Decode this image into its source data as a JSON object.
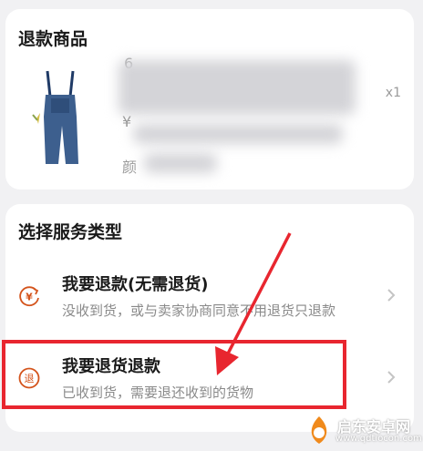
{
  "refund_items": {
    "title": "退款商品",
    "quantity": "x1",
    "fragment_top": "6",
    "fragment_mid": "¥",
    "fragment_bottom": "颜"
  },
  "service_type": {
    "title": "选择服务类型",
    "options": [
      {
        "title": "我要退款(无需退货)",
        "subtitle": "没收到货，或与卖家协商同意不用退货只退款",
        "icon_text": "¥"
      },
      {
        "title": "我要退货退款",
        "subtitle": "已收到货，需要退还收到的货物",
        "icon_text": "退"
      }
    ]
  },
  "colors": {
    "icon_orange": "#d4541c",
    "highlight_red": "#e8262f"
  },
  "watermark": {
    "title": "启东安卓网",
    "url": "www.qdtiocon.com"
  }
}
